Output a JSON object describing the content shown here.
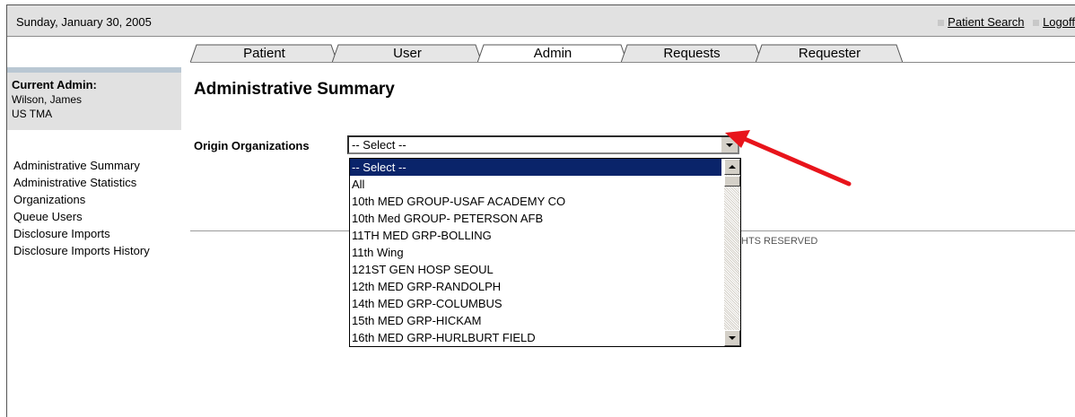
{
  "header": {
    "date": "Sunday, January 30, 2005",
    "links": [
      "Patient Search",
      "Logoff"
    ]
  },
  "tabs": [
    "Patient",
    "User",
    "Admin",
    "Requests",
    "Requester"
  ],
  "active_tab": "Admin",
  "sidebar": {
    "admin_label": "Current Admin:",
    "admin_name": "Wilson, James",
    "admin_org": "US TMA",
    "items": [
      "Administrative Summary",
      "Administrative Statistics",
      "Organizations",
      "Queue Users",
      "Disclosure Imports",
      "Disclosure Imports History"
    ]
  },
  "main": {
    "title": "Administrative Summary",
    "origin_label": "Origin Organizations",
    "select_value": "-- Select --",
    "options": [
      "-- Select --",
      "All",
      "10th MED GROUP-USAF ACADEMY CO",
      "10th Med GROUP- PETERSON AFB",
      "11TH MED GRP-BOLLING",
      "11th Wing",
      "121ST GEN HOSP SEOUL",
      "12th MED GRP-RANDOLPH",
      "14th MED GRP-COLUMBUS",
      "15th MED GRP-HICKAM",
      "16th MED GRP-HURLBURT FIELD"
    ],
    "selected_option": "-- Select --",
    "footer_partial": "HTS RESERVED"
  },
  "colors": {
    "topbar": "#e1e1e1",
    "selected_option": "#0a246a",
    "arrow": "#e8141b",
    "sidebar_accent": "#b9c7d3"
  }
}
